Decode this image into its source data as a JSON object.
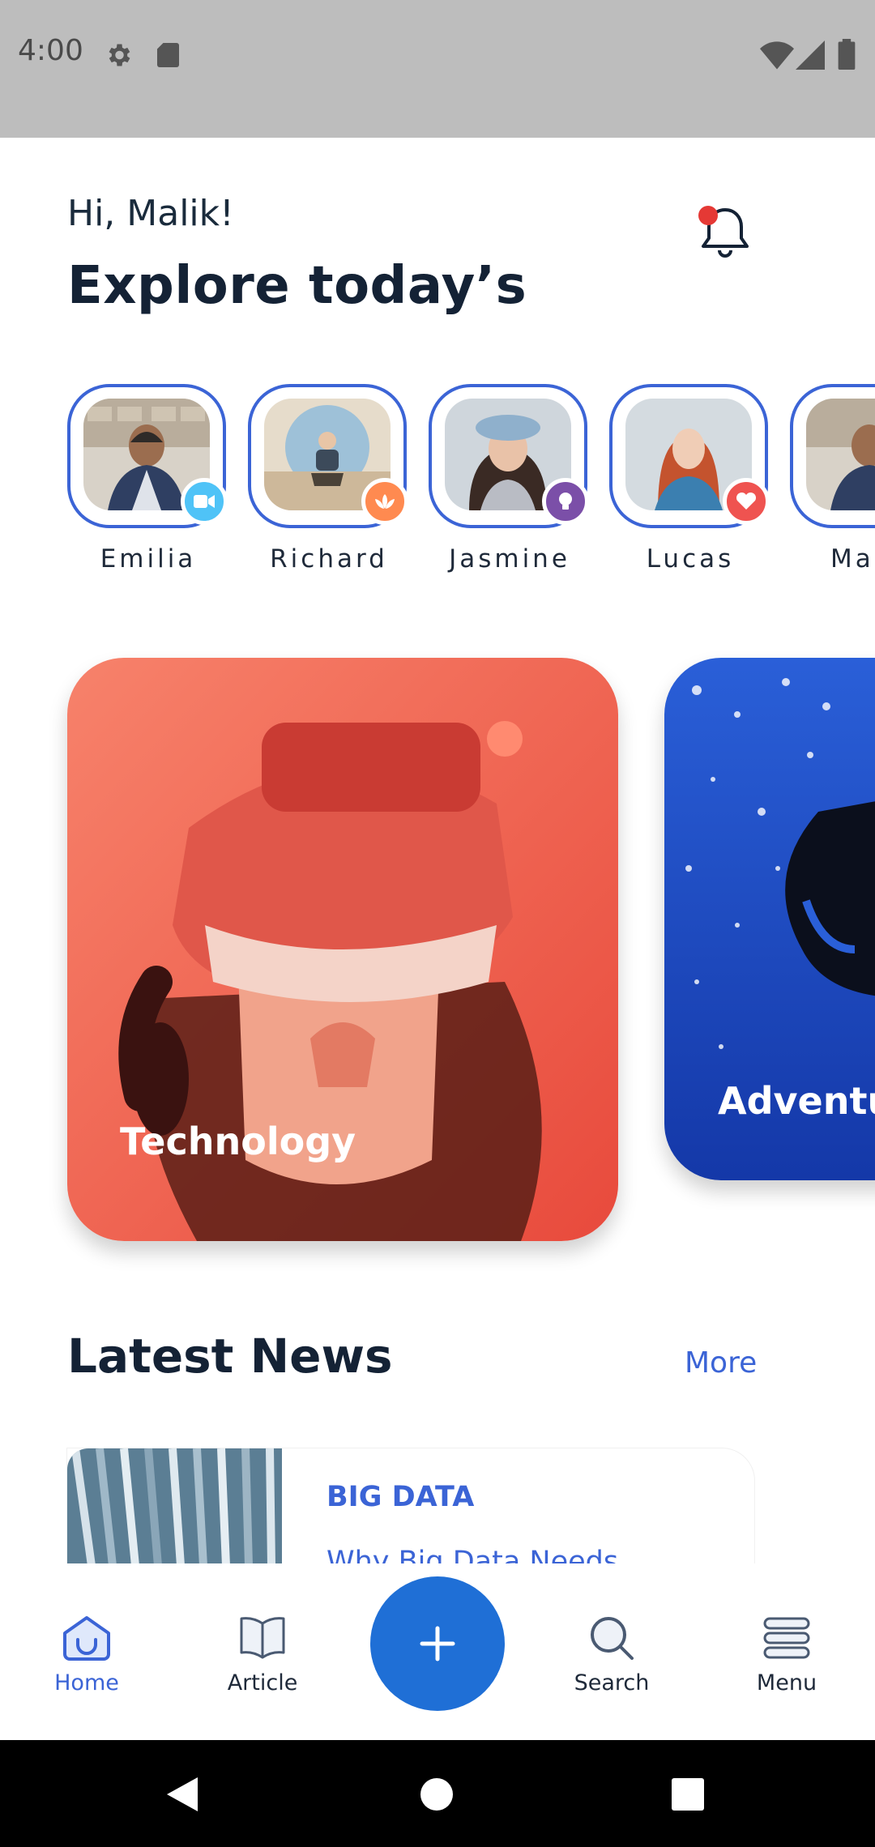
{
  "status_bar": {
    "time": "4:00",
    "icons": [
      "settings-icon",
      "sd-card-icon",
      "wifi-icon",
      "signal-icon",
      "battery-icon"
    ]
  },
  "header": {
    "greeting": "Hi, Malik!",
    "title": "Explore today’s",
    "notification_icon": "bell-icon",
    "notification_dot_color": "#e53935"
  },
  "stories": [
    {
      "name": "Emilia",
      "badge_icon": "video-icon",
      "badge_color": "#4fc3f7"
    },
    {
      "name": "Richard",
      "badge_icon": "lotus-icon",
      "badge_color": "#ff8a50"
    },
    {
      "name": "Jasmine",
      "badge_icon": "lightbulb-icon",
      "badge_color": "#7b4fa8"
    },
    {
      "name": "Lucas",
      "badge_icon": "heart-icon",
      "badge_color": "#ef5350"
    },
    {
      "name": "Ma",
      "badge_icon": "",
      "badge_color": ""
    }
  ],
  "categories": [
    {
      "label": "Technology",
      "theme_color": "#f0594a"
    },
    {
      "label": "Adventur",
      "theme_color": "#1e4fc8"
    }
  ],
  "latest_news": {
    "title": "Latest News",
    "more_label": "More",
    "items": [
      {
        "category": "BIG DATA",
        "headline": "Why Big Data Needs"
      }
    ]
  },
  "bottom_nav": {
    "items": [
      {
        "label": "Home",
        "icon": "home-icon",
        "active": true
      },
      {
        "label": "Article",
        "icon": "book-icon",
        "active": false
      },
      {
        "label": "Search",
        "icon": "search-icon",
        "active": false
      },
      {
        "label": "Menu",
        "icon": "menu-icon",
        "active": false
      }
    ],
    "fab_icon": "plus-icon"
  },
  "colors": {
    "accent": "#3b64d6",
    "fab": "#1f6fd6",
    "heading": "#142235"
  }
}
